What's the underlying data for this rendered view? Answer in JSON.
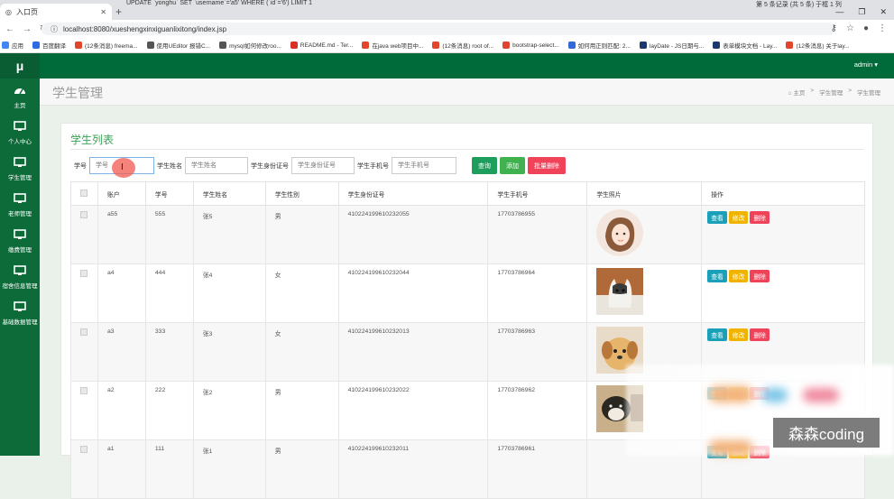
{
  "browser": {
    "tab_title": "入口页",
    "overlay_sql": "UPDATE `yonghu` SET `username`='a5' WHERE (`id`='6') LIMIT 1",
    "overlay_right": "第 5 条记录 (共 5 条) 于框 1 列",
    "url": "localhost:8080/xueshengxinxiguanlixitong/index.jsp",
    "bookmarks": [
      {
        "label": "应用",
        "color": "#4285f4"
      },
      {
        "label": "百度翻译",
        "color": "#2d6be4"
      },
      {
        "label": "(12条消息) freema...",
        "color": "#e2452d"
      },
      {
        "label": "使用UEditor 报错C...",
        "color": "#555555"
      },
      {
        "label": "mysql如何修改roo...",
        "color": "#555555"
      },
      {
        "label": "README.md - Ter...",
        "color": "#d93025"
      },
      {
        "label": "在java web项目中...",
        "color": "#e2452d"
      },
      {
        "label": "(12条消息) root of...",
        "color": "#e2452d"
      },
      {
        "label": "bootstrap-select...",
        "color": "#e2452d"
      },
      {
        "label": "如何用正则匹配: 2...",
        "color": "#3367d6"
      },
      {
        "label": "layDate - JS日期与...",
        "color": "#1a3a6b"
      },
      {
        "label": "表单模块文档 - Lay...",
        "color": "#1a3a6b"
      },
      {
        "label": "(12条消息) 关于lay...",
        "color": "#e2452d"
      }
    ]
  },
  "sidebar": {
    "logo": "μ",
    "items": [
      {
        "label": "主页",
        "icon": "dashboard-icon"
      },
      {
        "label": "个人中心",
        "icon": "monitor-icon"
      },
      {
        "label": "学生管理",
        "icon": "monitor-icon"
      },
      {
        "label": "老师管理",
        "icon": "monitor-icon"
      },
      {
        "label": "缴费管理",
        "icon": "monitor-icon"
      },
      {
        "label": "宿舍信息管理",
        "icon": "monitor-icon"
      },
      {
        "label": "基础数据管理",
        "icon": "monitor-icon"
      }
    ]
  },
  "topbar": {
    "user": "admin ▾"
  },
  "header": {
    "title": "学生管理",
    "breadcrumbs": [
      "⌂ 主页",
      ">",
      "学生管理",
      ">",
      "学生管理"
    ]
  },
  "panel": {
    "title": "学生列表",
    "search": {
      "fields": [
        {
          "label": "学号",
          "placeholder": "学号"
        },
        {
          "label": "学生姓名",
          "placeholder": "学生姓名"
        },
        {
          "label": "学生身份证号",
          "placeholder": "学生身份证号"
        },
        {
          "label": "学生手机号",
          "placeholder": "学生手机号"
        }
      ],
      "buttons": [
        {
          "label": "查询",
          "color": "#1e9e5c"
        },
        {
          "label": "添加",
          "color": "#3fb14f"
        },
        {
          "label": "批量删除",
          "color": "#f0435a"
        }
      ]
    },
    "table": {
      "headers": [
        "",
        "账户",
        "学号",
        "学生姓名",
        "学生性别",
        "学生身份证号",
        "学生手机号",
        "学生照片",
        "操作"
      ],
      "rows": [
        {
          "account": "a55",
          "id": "555",
          "name": "张5",
          "gender": "男",
          "idcard": "410224199610232055",
          "phone": "17703786955",
          "photo": "girl"
        },
        {
          "account": "a4",
          "id": "444",
          "name": "张4",
          "gender": "女",
          "idcard": "410224199610232044",
          "phone": "17703786964",
          "photo": "cat"
        },
        {
          "account": "a3",
          "id": "333",
          "name": "张3",
          "gender": "女",
          "idcard": "410224199610232013",
          "phone": "17703786963",
          "photo": "puppy"
        },
        {
          "account": "a2",
          "id": "222",
          "name": "张2",
          "gender": "男",
          "idcard": "410224199610232022",
          "phone": "17703786962",
          "photo": "dog"
        },
        {
          "account": "a1",
          "id": "111",
          "name": "张1",
          "gender": "男",
          "idcard": "410224199610232011",
          "phone": "17703786961",
          "photo": "none"
        }
      ],
      "actions": [
        {
          "label": "查看",
          "color": "#1aa0b8"
        },
        {
          "label": "修改",
          "color": "#f0b400"
        },
        {
          "label": "删除",
          "color": "#f0435a"
        }
      ]
    }
  },
  "watermark": "森森coding"
}
